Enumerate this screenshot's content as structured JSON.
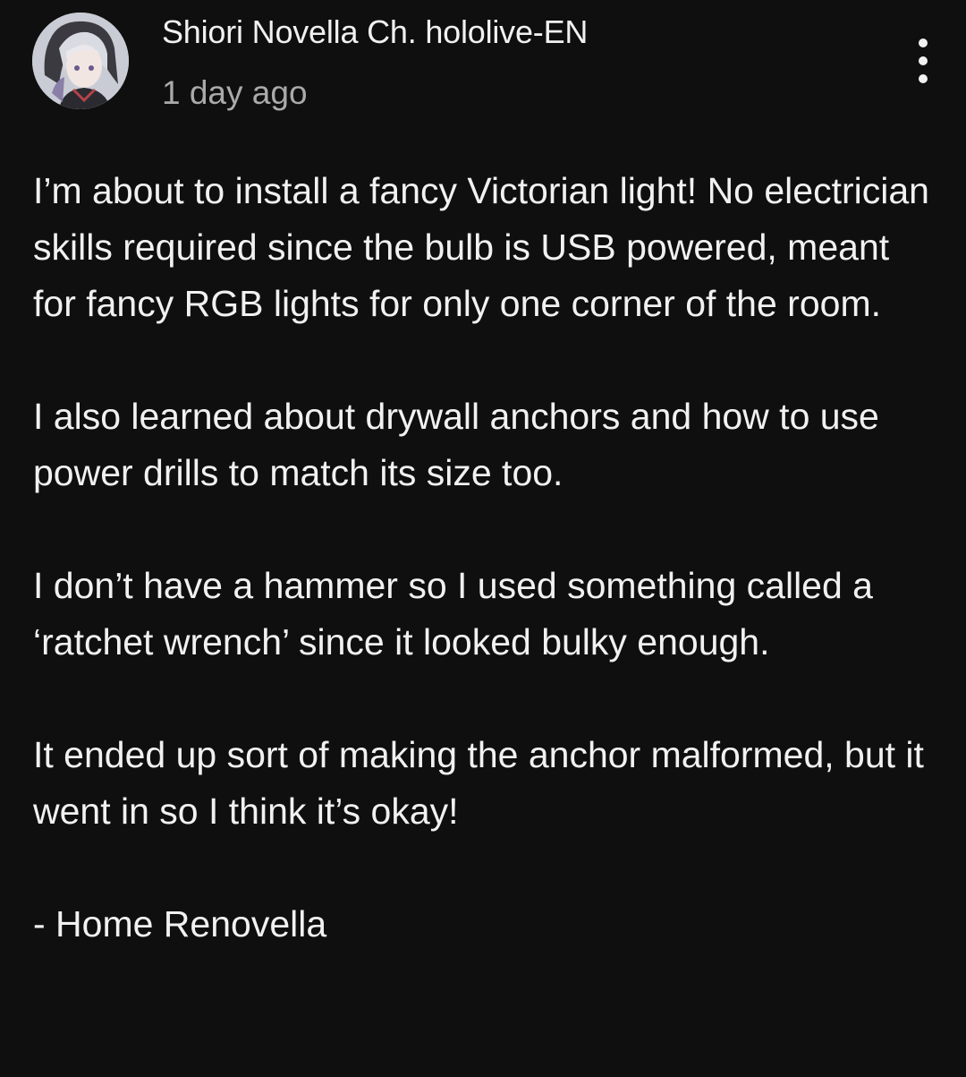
{
  "post": {
    "author": "Shiori Novella Ch. hololive-EN",
    "time": "1 day ago",
    "menu_icon": "more-vertical-icon",
    "avatar_icon": "channel-avatar",
    "paragraphs": [
      "I’m about to install a fancy Victorian light! No electrician skills required since the bulb is USB powered, meant for fancy RGB lights for only one corner of the room.",
      "I also learned about drywall anchors and how to use power drills to match its size too.",
      "I don’t have a hammer so I used something called a ‘ratchet wrench’ since it looked bulky enough.",
      "It ended up sort of making the anchor malformed, but it went in so I think it’s okay!",
      "- Home Renovella"
    ]
  },
  "colors": {
    "background": "#0f0f0f",
    "text": "#f1f1f1",
    "secondary_text": "#aaaaaa"
  }
}
